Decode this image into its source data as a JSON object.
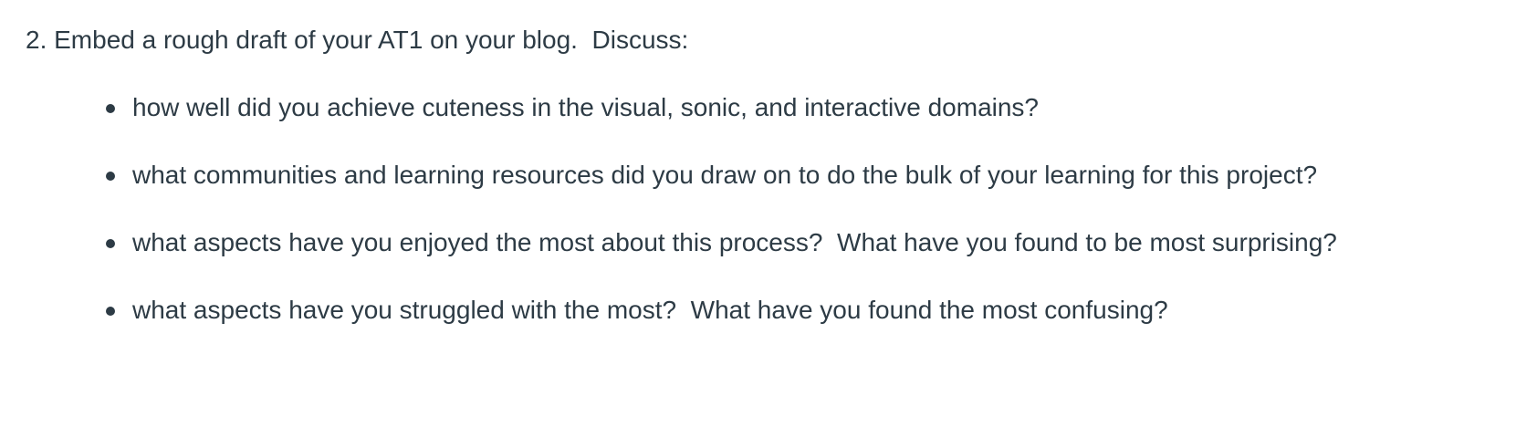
{
  "prompt": {
    "text": "2. Embed a rough draft of your AT1 on your blog.  Discuss:"
  },
  "bullets": [
    {
      "text": "how well did you achieve cuteness in the visual, sonic, and interactive domains?"
    },
    {
      "text": "what communities and learning resources did you draw on to do the bulk of your learning for this project?"
    },
    {
      "text": "what aspects have you enjoyed the most about this process?  What have you found to be most surprising?"
    },
    {
      "text": "what aspects have you struggled with the most?  What have you found the most confusing?"
    }
  ]
}
